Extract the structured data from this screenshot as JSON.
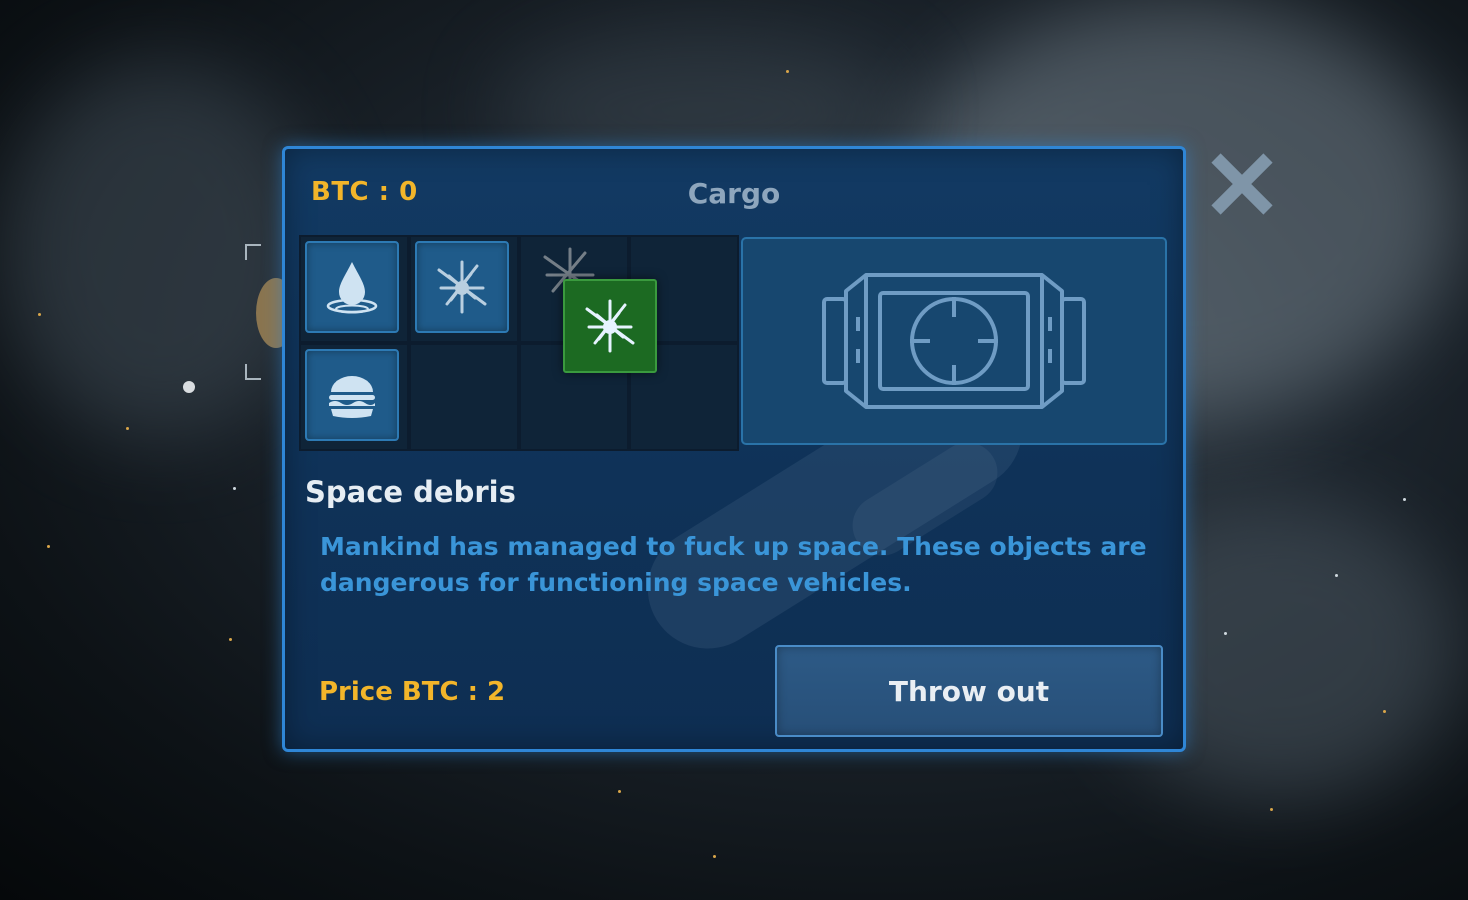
{
  "hud": {
    "btc_balance_label": "BTC :  0",
    "title": "Cargo"
  },
  "inventory": {
    "slots": [
      {
        "item": "water-drop-icon"
      },
      {
        "item": "space-debris-icon"
      },
      {
        "item": "space-debris-icon",
        "state": "ghost"
      },
      {
        "item": ""
      },
      {
        "item": "burger-icon"
      },
      {
        "item": ""
      },
      {
        "item": ""
      },
      {
        "item": ""
      }
    ],
    "dragged_item": "space-debris-icon",
    "preview_icon": "cargo-capsule-icon"
  },
  "selected_item": {
    "name": "Space debris",
    "description": "Mankind has managed to fuck up space. These objects are dangerous for functioning space vehicles.",
    "price_label": "Price BTC :  2"
  },
  "actions": {
    "throw_out_label": "Throw out"
  },
  "colors": {
    "accent_gold": "#f2b52a",
    "panel_border": "#2f86d6",
    "description_blue": "#3a95d8",
    "drag_green": "#1c6a22"
  }
}
